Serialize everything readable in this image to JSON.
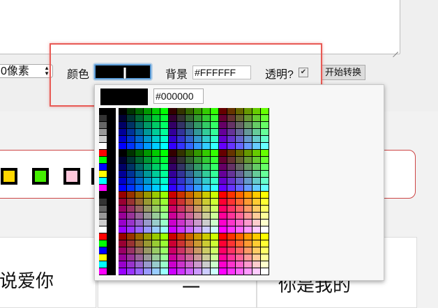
{
  "toolbar": {
    "size_value": "0像素",
    "color_label": "颜色",
    "background_label": "背景",
    "background_value": "#FFFFFF",
    "transparent_label": "透明?",
    "transparent_checked": true,
    "start_button": "开始转换"
  },
  "picker": {
    "hex_value": "#000000",
    "selected_color": "#000000"
  },
  "swatches": [
    "#ffd800",
    "#44ee00",
    "#ffc8dc"
  ],
  "card_texts": [
    "说爱你",
    "一",
    "你是我的"
  ],
  "colors": {
    "highlight": "#e85a55",
    "focus": "#5b9dd9"
  }
}
